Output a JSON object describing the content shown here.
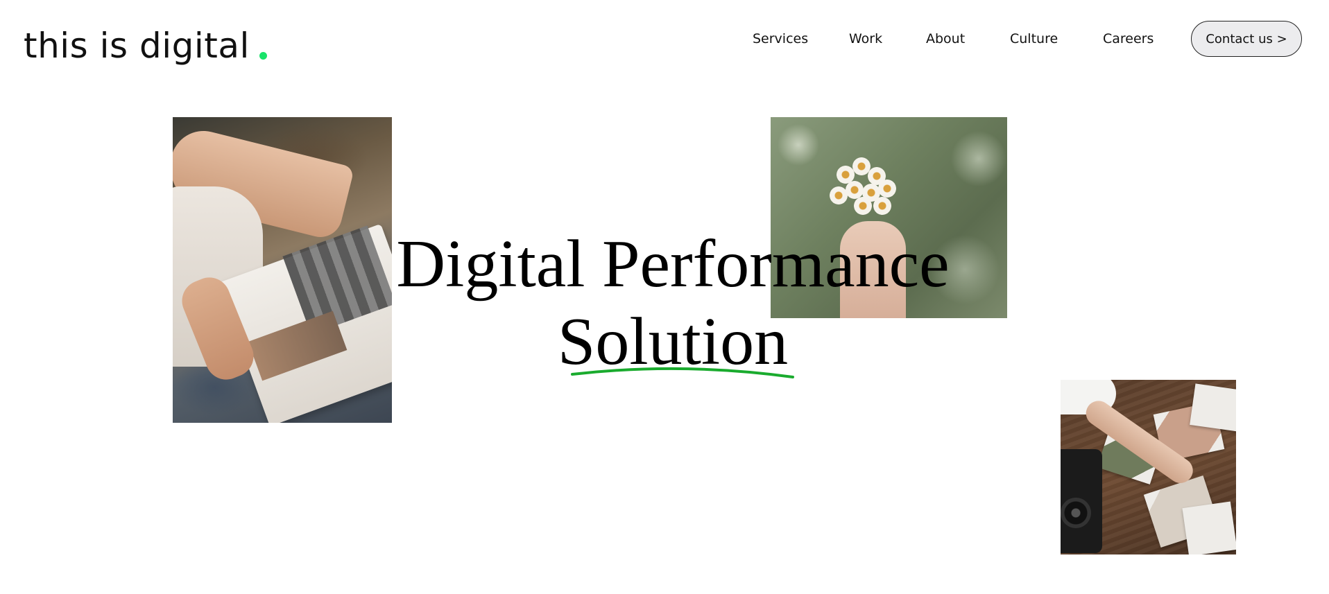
{
  "header": {
    "logo_text": "this is digital",
    "logo_dot_color": "#19e36a",
    "nav": [
      {
        "label": "Services"
      },
      {
        "label": "Work"
      },
      {
        "label": "About"
      },
      {
        "label": "Culture"
      },
      {
        "label": "Careers"
      }
    ],
    "contact_label": "Contact us >"
  },
  "hero": {
    "headline_line1": "Digital Performance",
    "headline_line2": "Solution",
    "underline_color": "#1aab2e",
    "images": [
      {
        "name": "photo-reading-magazine"
      },
      {
        "name": "photo-hand-holding-daisies"
      },
      {
        "name": "photo-camera-and-prints-on-table"
      }
    ]
  }
}
